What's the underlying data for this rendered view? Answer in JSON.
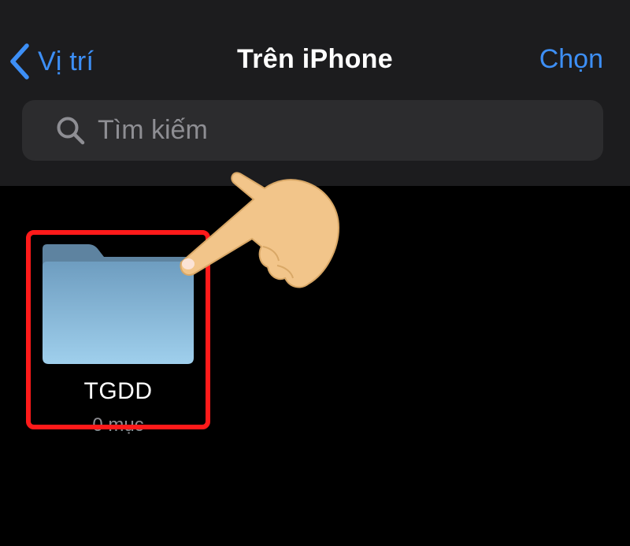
{
  "nav": {
    "back_label": "Vị trí",
    "title": "Trên iPhone",
    "action_label": "Chọn"
  },
  "search": {
    "placeholder": "Tìm kiếm",
    "value": ""
  },
  "items": [
    {
      "name": "TGDD",
      "subtitle": "0 mục",
      "icon": "folder-icon"
    }
  ],
  "icons": {
    "back": "chevron-left-icon",
    "search": "search-icon",
    "pointer": "pointing-hand-icon"
  },
  "colors": {
    "accent": "#3d8ff6",
    "header_bg": "#1c1c1e",
    "search_bg": "#2c2c2e",
    "content_bg": "#000000",
    "highlight": "#ff1a1a",
    "folder": "#8fc5e8"
  }
}
